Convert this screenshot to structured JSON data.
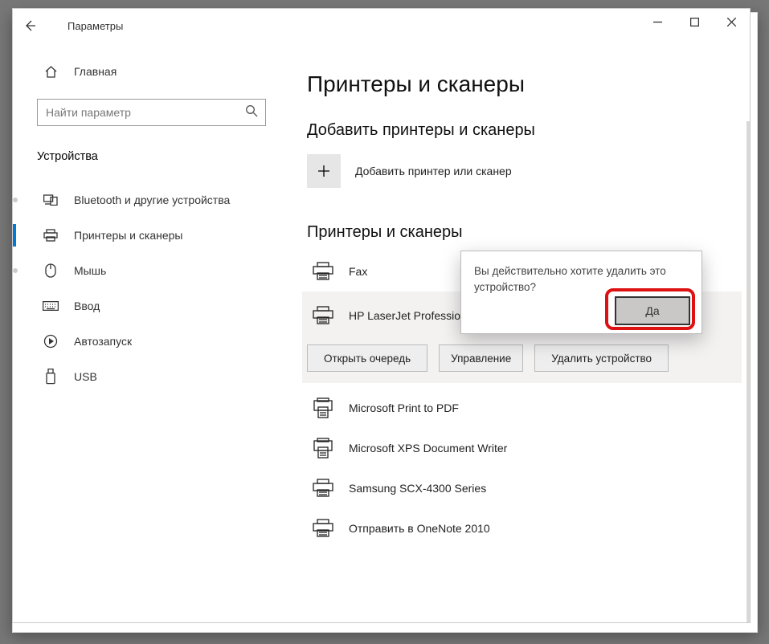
{
  "window": {
    "title": "Параметры"
  },
  "sidebar": {
    "home_label": "Главная",
    "search_placeholder": "Найти параметр",
    "category_label": "Устройства",
    "items": [
      {
        "label": "Bluetooth и другие устройства"
      },
      {
        "label": "Принтеры и сканеры"
      },
      {
        "label": "Мышь"
      },
      {
        "label": "Ввод"
      },
      {
        "label": "Автозапуск"
      },
      {
        "label": "USB"
      }
    ]
  },
  "main": {
    "page_title": "Принтеры и сканеры",
    "add_section_title": "Добавить принтеры и сканеры",
    "add_label": "Добавить принтер или сканер",
    "list_section_title": "Принтеры и сканеры",
    "printers": [
      {
        "label": "Fax"
      },
      {
        "label": "HP LaserJet Professional M"
      },
      {
        "label": "Microsoft Print to PDF"
      },
      {
        "label": "Microsoft XPS Document Writer"
      },
      {
        "label": "Samsung SCX-4300 Series"
      },
      {
        "label": "Отправить в OneNote 2010"
      }
    ],
    "actions": {
      "open_queue": "Открыть очередь",
      "manage": "Управление",
      "remove": "Удалить устройство"
    }
  },
  "confirm": {
    "text": "Вы действительно хотите удалить это устройство?",
    "yes": "Да"
  }
}
